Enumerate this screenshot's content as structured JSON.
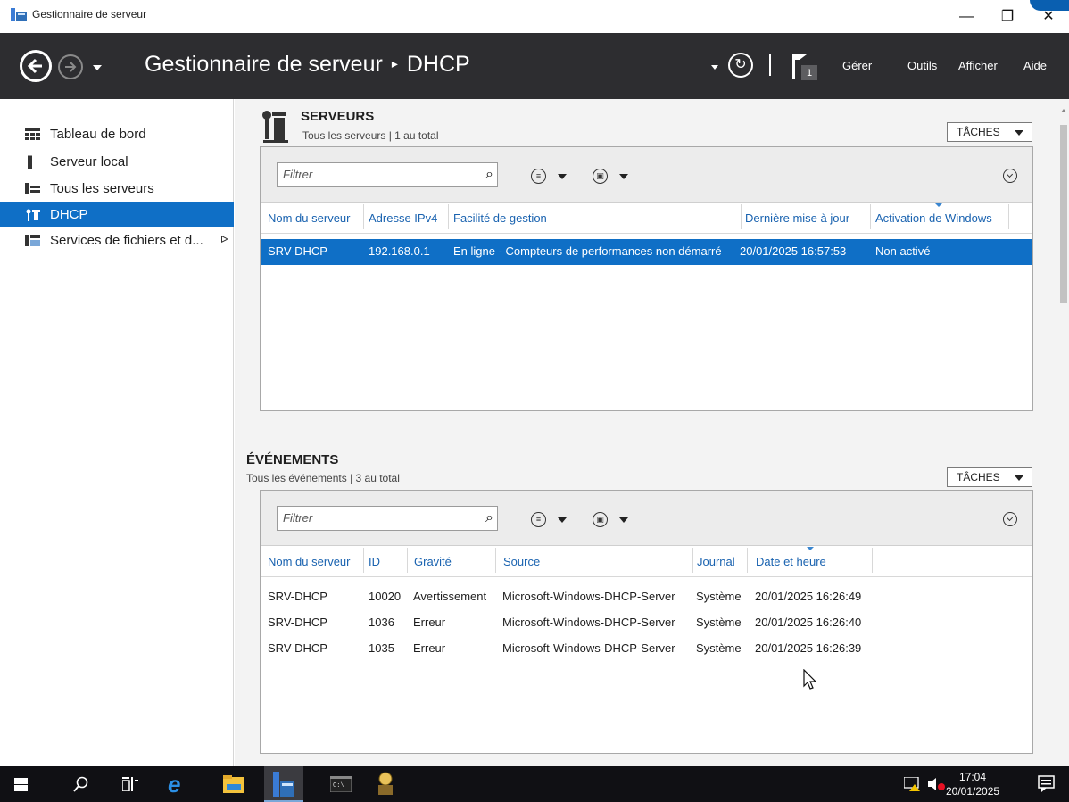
{
  "window": {
    "title": "Gestionnaire de serveur",
    "controls": {
      "minimize": "—",
      "maximize": "❐",
      "close": "✕"
    }
  },
  "header": {
    "breadcrumb_root": "Gestionnaire de serveur",
    "breadcrumb_sep": "▸",
    "breadcrumb_current": "DHCP",
    "flag_count": "1",
    "menus": [
      "Gérer",
      "Outils",
      "Afficher",
      "Aide"
    ]
  },
  "sidebar": {
    "items": [
      {
        "label": "Tableau de bord",
        "icon": "dashboard-icon"
      },
      {
        "label": "Serveur local",
        "icon": "local-server-icon"
      },
      {
        "label": "Tous les serveurs",
        "icon": "all-servers-icon"
      },
      {
        "label": "DHCP",
        "icon": "dhcp-icon",
        "active": true
      },
      {
        "label": "Services de fichiers et d...",
        "icon": "file-services-icon",
        "expand_glyph": "ᐅ"
      }
    ]
  },
  "servers": {
    "title": "SERVEURS",
    "subtitle": "Tous les serveurs | 1 au total",
    "tasks_label": "TÂCHES",
    "filter_placeholder": "Filtrer",
    "columns": [
      "Nom du serveur",
      "Adresse IPv4",
      "Facilité de gestion",
      "Dernière mise à jour",
      "Activation de Windows"
    ],
    "rows": [
      [
        "SRV-DHCP",
        "192.168.0.1",
        "En ligne - Compteurs de performances non démarré",
        "20/01/2025 16:57:53",
        "Non activé"
      ]
    ]
  },
  "events": {
    "title": "ÉVÉNEMENTS",
    "subtitle": "Tous les événements | 3 au total",
    "tasks_label": "TÂCHES",
    "filter_placeholder": "Filtrer",
    "columns": [
      "Nom du serveur",
      "ID",
      "Gravité",
      "Source",
      "Journal",
      "Date et heure"
    ],
    "rows": [
      [
        "SRV-DHCP",
        "10020",
        "Avertissement",
        "Microsoft-Windows-DHCP-Server",
        "Système",
        "20/01/2025 16:26:49"
      ],
      [
        "SRV-DHCP",
        "1036",
        "Erreur",
        "Microsoft-Windows-DHCP-Server",
        "Système",
        "20/01/2025 16:26:40"
      ],
      [
        "SRV-DHCP",
        "1035",
        "Erreur",
        "Microsoft-Windows-DHCP-Server",
        "Système",
        "20/01/2025 16:26:39"
      ]
    ]
  },
  "taskbar": {
    "time": "17:04",
    "date": "20/01/2025"
  },
  "colors": {
    "accent": "#0f6fc6",
    "header_bg": "#2d2d30",
    "link": "#1a63b0"
  }
}
